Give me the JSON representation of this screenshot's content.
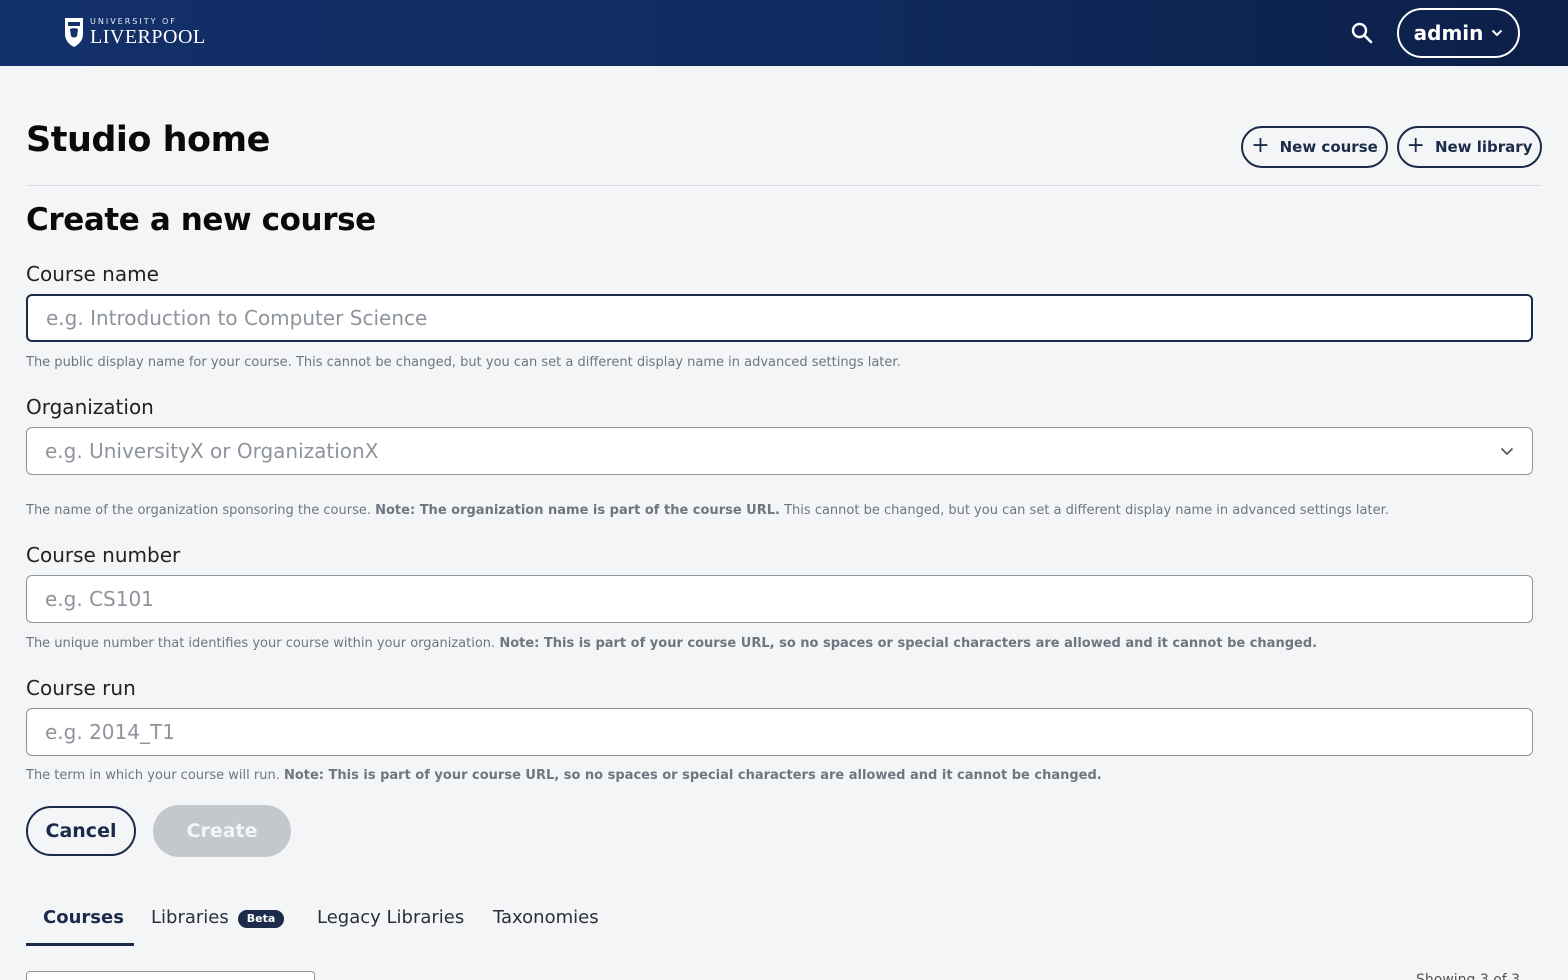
{
  "header": {
    "logo_small": "UNIVERSITY OF",
    "logo_big": "LIVERPOOL",
    "user_label": "admin",
    "icons": {
      "search": "search-icon",
      "chevron": "chevron-down-icon"
    }
  },
  "page": {
    "title": "Studio home",
    "new_course_label": "New course",
    "new_library_label": "New library"
  },
  "form": {
    "title": "Create a new course",
    "course_name": {
      "label": "Course name",
      "placeholder": "e.g. Introduction to Computer Science",
      "help": "The public display name for your course. This cannot be changed, but you can set a different display name in advanced settings later."
    },
    "organization": {
      "label": "Organization",
      "placeholder": "e.g. UniversityX or OrganizationX",
      "help_prefix": "The name of the organization sponsoring the course. ",
      "help_note": "Note: The organization name is part of the course URL.",
      "help_suffix": " This cannot be changed, but you can set a different display name in advanced settings later."
    },
    "course_number": {
      "label": "Course number",
      "placeholder": "e.g. CS101",
      "help_prefix": "The unique number that identifies your course within your organization. ",
      "help_note": "Note: This is part of your course URL, so no spaces or special characters are allowed and it cannot be changed."
    },
    "course_run": {
      "label": "Course run",
      "placeholder": "e.g. 2014_T1",
      "help_prefix": "The term in which your course will run. ",
      "help_note": "Note: This is part of your course URL, so no spaces or special characters are allowed and it cannot be changed."
    },
    "cancel_label": "Cancel",
    "create_label": "Create"
  },
  "tabs": [
    {
      "label": "Courses",
      "active": true
    },
    {
      "label": "Libraries",
      "badge": "Beta"
    },
    {
      "label": "Legacy Libraries"
    },
    {
      "label": "Taxonomies"
    }
  ],
  "list": {
    "showing_text": "Showing 3 of 3"
  },
  "colors": {
    "header_bg": "#12306a",
    "primary": "#1c2b4a",
    "page_bg": "#f3f5f7",
    "disabled_button": "#c4c8cc"
  }
}
